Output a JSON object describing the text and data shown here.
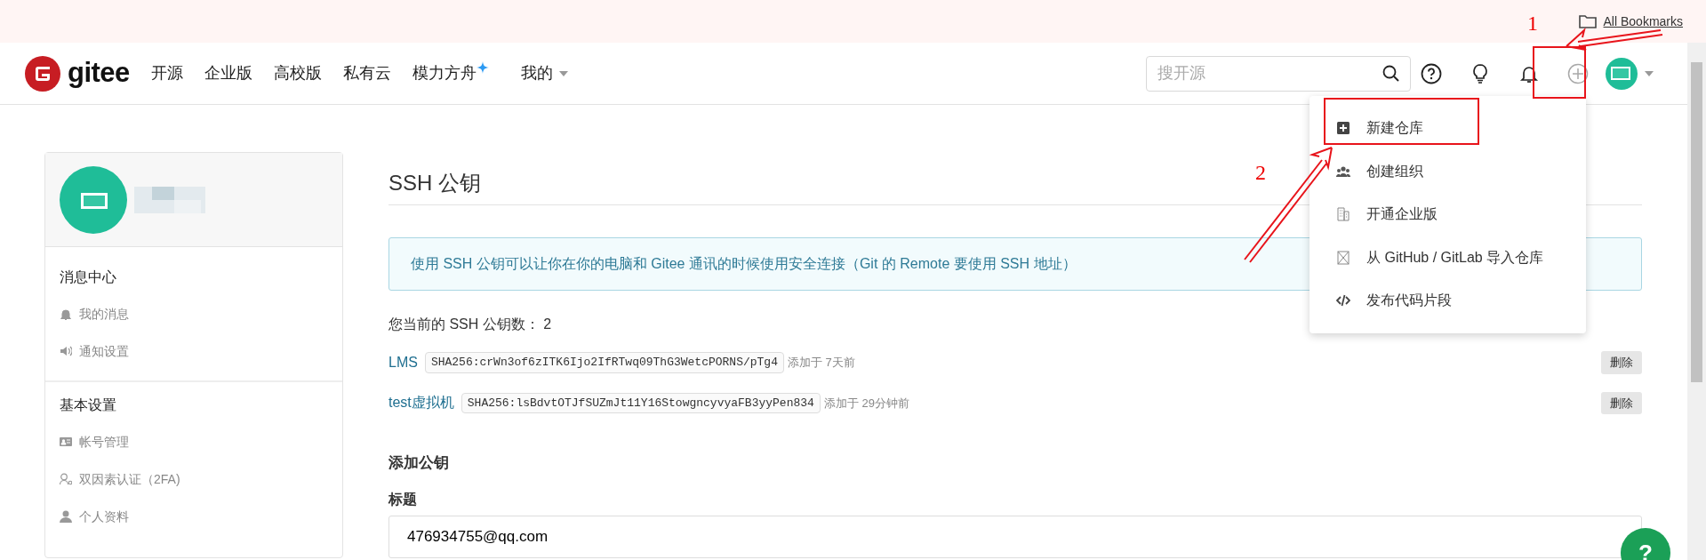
{
  "bookmarks_bar": {
    "items": [
      {
        "label": "All Bookmarks"
      }
    ]
  },
  "navbar": {
    "logo": "gitee",
    "links": [
      {
        "label": "开源",
        "kind": "plain"
      },
      {
        "label": "企业版",
        "kind": "plain"
      },
      {
        "label": "高校版",
        "kind": "plain"
      },
      {
        "label": "私有云",
        "kind": "plain"
      },
      {
        "label": "模力方舟",
        "kind": "sparkle"
      },
      {
        "label": "我的",
        "kind": "dropdown"
      }
    ],
    "search": {
      "placeholder": "搜开源"
    },
    "create_menu_expanded": true
  },
  "create_menu": {
    "items": [
      {
        "label": "新建仓库"
      },
      {
        "label": "创建组织"
      },
      {
        "label": "开通企业版"
      },
      {
        "label": "从 GitHub / GitLab 导入仓库"
      },
      {
        "label": "发布代码片段"
      }
    ]
  },
  "sidebar": {
    "sections": [
      {
        "title": "消息中心",
        "items": [
          {
            "label": "我的消息"
          },
          {
            "label": "通知设置"
          }
        ]
      },
      {
        "title": "基本设置",
        "items": [
          {
            "label": "帐号管理"
          },
          {
            "label": "双因素认证（2FA)"
          },
          {
            "label": "个人资料"
          }
        ]
      }
    ]
  },
  "main": {
    "title": "SSH 公钥",
    "alert": "使用 SSH 公钥可以让你在你的电脑和 Gitee 通讯的时候使用安全连接（Git 的 Remote 要使用 SSH 地址）",
    "count_text": "您当前的 SSH 公钥数： 2",
    "keys": [
      {
        "name": "LMS",
        "fingerprint": "SHA256:crWn3of6zITK6Ijo2IfRTwq09ThG3WetcPORNS/pTg4",
        "added": "添加于 7天前",
        "delete_label": "删除"
      },
      {
        "name": "test虚拟机",
        "fingerprint": "SHA256:lsBdvtOTJfSUZmJt11Y16StowgncyvyaFB3yyPen834",
        "added": "添加于 29分钟前",
        "delete_label": "删除"
      }
    ],
    "add_heading": "添加公钥",
    "fields": [
      {
        "label": "标题",
        "value": "476934755@qq.com"
      }
    ]
  },
  "help_button": {
    "label": "?"
  },
  "annotations": [
    {
      "text": "1"
    },
    {
      "text": "2"
    }
  ]
}
